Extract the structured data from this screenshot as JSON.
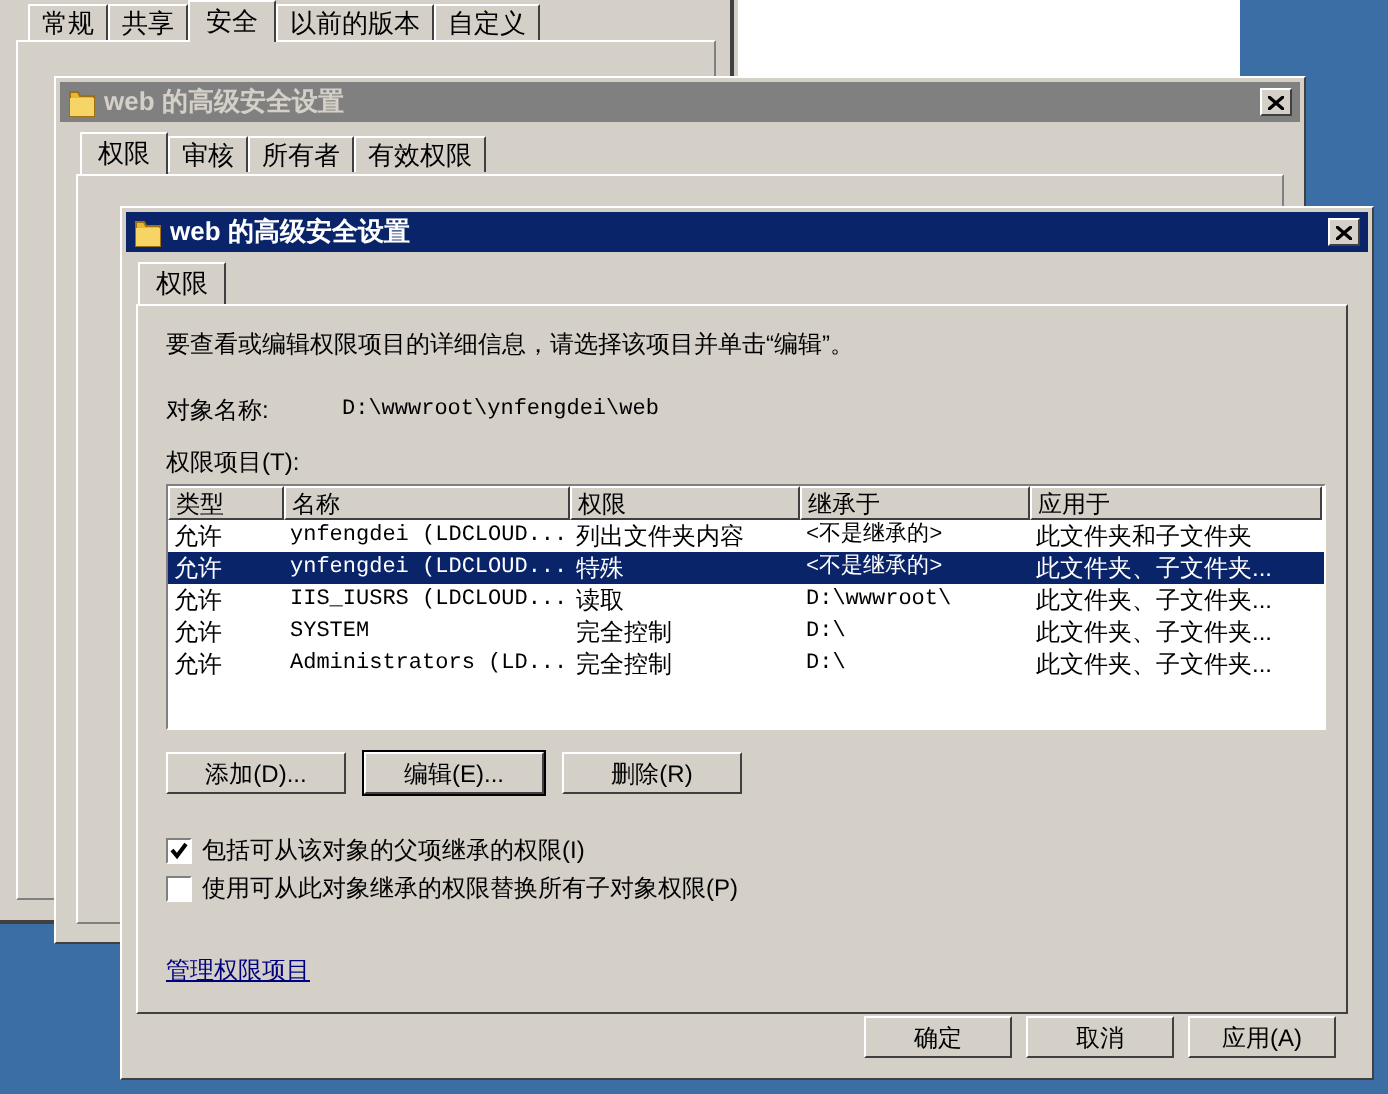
{
  "back_window": {
    "tabs": [
      {
        "label": "常规",
        "selected": false
      },
      {
        "label": "共享",
        "selected": false
      },
      {
        "label": "安全",
        "selected": true
      },
      {
        "label": "以前的版本",
        "selected": false
      },
      {
        "label": "自定义",
        "selected": false
      }
    ]
  },
  "middle_window": {
    "title": "web 的高级安全设置",
    "active": false,
    "tabs": [
      {
        "label": "权限",
        "selected": true
      },
      {
        "label": "审核",
        "selected": false
      },
      {
        "label": "所有者",
        "selected": false
      },
      {
        "label": "有效权限",
        "selected": false
      }
    ]
  },
  "front_window": {
    "title": "web 的高级安全设置",
    "active": true,
    "tabs": [
      {
        "label": "权限",
        "selected": true
      }
    ],
    "instruction": "要查看或编辑权限项目的详细信息，请选择该项目并单击“编辑”。",
    "object_name_label": "对象名称:",
    "object_name": "D:\\wwwroot\\ynfengdei\\web",
    "list_label": "权限项目(T):",
    "table": {
      "columns": [
        "类型",
        "名称",
        "权限",
        "继承于",
        "应用于"
      ],
      "rows": [
        {
          "cells": [
            "允许",
            "ynfengdei (LDCLOUD...",
            "列出文件夹内容",
            "<不是继承的>",
            "此文件夹和子文件夹"
          ],
          "selected": false
        },
        {
          "cells": [
            "允许",
            "ynfengdei (LDCLOUD...",
            "特殊",
            "<不是继承的>",
            "此文件夹、子文件夹..."
          ],
          "selected": true
        },
        {
          "cells": [
            "允许",
            "IIS_IUSRS (LDCLOUD...",
            "读取",
            "D:\\wwwroot\\",
            "此文件夹、子文件夹..."
          ],
          "selected": false
        },
        {
          "cells": [
            "允许",
            "SYSTEM",
            "完全控制",
            "D:\\",
            "此文件夹、子文件夹..."
          ],
          "selected": false
        },
        {
          "cells": [
            "允许",
            "Administrators (LD...",
            "完全控制",
            "D:\\",
            "此文件夹、子文件夹..."
          ],
          "selected": false
        }
      ]
    },
    "list_buttons": [
      {
        "label": "添加(D)...",
        "default": false
      },
      {
        "label": "编辑(E)...",
        "default": true
      },
      {
        "label": "删除(R)",
        "default": false
      }
    ],
    "checkboxes": [
      {
        "label": "包括可从该对象的父项继承的权限(I)",
        "checked": true
      },
      {
        "label": "使用可从此对象继承的权限替换所有子对象权限(P)",
        "checked": false
      }
    ],
    "link": "管理权限项目",
    "buttons": [
      "确定",
      "取消",
      "应用(A)"
    ]
  }
}
